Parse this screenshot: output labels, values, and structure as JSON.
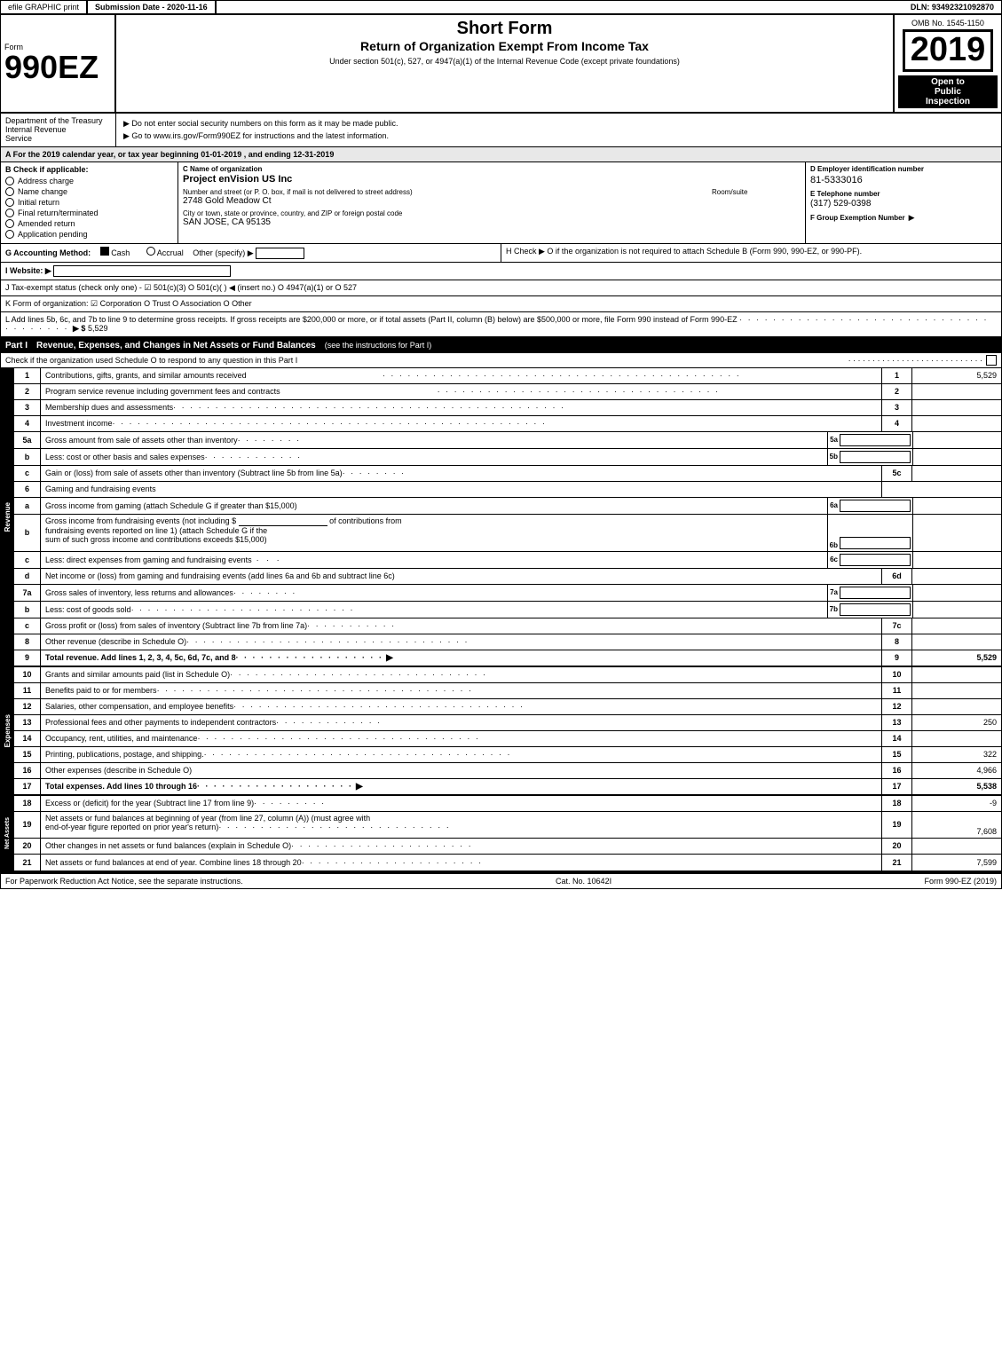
{
  "topbar": {
    "efile": "efile GRAPHIC print",
    "submission_label": "Submission Date - 2020-11-16",
    "dln_label": "DLN: 93492321092870"
  },
  "header": {
    "omb": "OMB No. 1545-1150",
    "form_number": "990EZ",
    "form_sub": "Form",
    "title_line1": "Short Form",
    "title_line2": "Return of Organization Exempt From Income Tax",
    "title_sub": "Under section 501(c), 527, or 4947(a)(1) of the Internal Revenue Code (except private foundations)",
    "year": "2019",
    "open_to_public": "Open to",
    "public": "Public",
    "inspection": "Inspection"
  },
  "instructions": {
    "no_ssn": "▶ Do not enter social security numbers on this form as it may be made public.",
    "goto": "▶ Go to www.irs.gov/Form990EZ for instructions and the latest information.",
    "dept": "Department of the Treasury",
    "treasury": "Internal Revenue",
    "service": "Service"
  },
  "sectionA": {
    "text": "A  For the 2019 calendar year, or tax year beginning 01-01-2019 , and ending 12-31-2019"
  },
  "sectionB": {
    "label": "B  Check if applicable:",
    "items": [
      "Address charge",
      "Name change",
      "Initial return",
      "Final return/terminated",
      "Amended return",
      "Application pending"
    ]
  },
  "sectionC": {
    "label": "C Name of organization",
    "org_name": "Project enVision US Inc",
    "address_label": "Number and street (or P. O. box, if mail is not delivered to street address)",
    "address_value": "2748 Gold Meadow Ct",
    "room_label": "Room/suite",
    "room_value": "",
    "city_label": "City or town, state or province, country, and ZIP or foreign postal code",
    "city_value": "SAN JOSE, CA  95135"
  },
  "sectionD": {
    "label": "D Employer identification number",
    "ein": "81-5333016",
    "phone_label": "E Telephone number",
    "phone": "(317) 529-0398",
    "group_label": "F Group Exemption Number",
    "group_value": ""
  },
  "sectionG": {
    "label": "G Accounting Method:",
    "cash": "Cash",
    "accrual": "Accrual",
    "other": "Other (specify) ▶"
  },
  "sectionH": {
    "text": "H  Check ▶  O if the organization is not required to attach Schedule B (Form 990, 990-EZ, or 990-PF)."
  },
  "websiteRow": {
    "label": "I Website: ▶"
  },
  "taxRow": {
    "text": "J Tax-exempt status (check only one) - ☑ 501(c)(3)  O 501(c)(   ) ◀ (insert no.)  O 4947(a)(1) or  O 527"
  },
  "formOrgRow": {
    "text": "K Form of organization:  ☑ Corporation    O Trust    O Association    O Other"
  },
  "sectionL": {
    "text": "L Add lines 5b, 6c, and 7b to line 9 to determine gross receipts. If gross receipts are $200,000 or more, or if total assets (Part II, column (B) below) are $500,000 or more, file Form 990 instead of Form 990-EZ",
    "dots": "· · · · · · · · · · · · · · · · · · · · · · · · · · · · · · · · · ·",
    "arrow": "▶ $",
    "value": "5,529"
  },
  "partI": {
    "label": "Part I",
    "title": "Revenue, Expenses, and Changes in Net Assets or Fund Balances",
    "see_instructions": "(see the instructions for Part I)",
    "check_text": "Check if the organization used Schedule O to respond to any question in this Part I",
    "rows": [
      {
        "num": "1",
        "desc": "Contributions, gifts, grants, and similar amounts received",
        "dots": true,
        "line": "1",
        "value": "5,529"
      },
      {
        "num": "2",
        "desc": "Program service revenue including government fees and contracts",
        "dots": true,
        "line": "2",
        "value": ""
      },
      {
        "num": "3",
        "desc": "Membership dues and assessments",
        "dots": true,
        "line": "3",
        "value": ""
      },
      {
        "num": "4",
        "desc": "Investment income",
        "dots": true,
        "line": "4",
        "value": ""
      }
    ],
    "row5": {
      "a": {
        "desc": "Gross amount from sale of assets other than inventory",
        "dots": false,
        "sub": "5a",
        "value": ""
      },
      "b": {
        "desc": "Less: cost or other basis and sales expenses",
        "dots": true,
        "sub": "5b",
        "value": ""
      },
      "c": {
        "desc": "Gain or (loss) from sale of assets other than inventory (Subtract line 5b from line 5a)",
        "dots": true,
        "line": "5c",
        "value": ""
      }
    },
    "row6": {
      "desc": "Gaming and fundraising events",
      "a": {
        "desc": "Gross income from gaming (attach Schedule G if greater than $15,000)",
        "sub": "6a",
        "value": ""
      },
      "b": {
        "desc": "Gross income from fundraising events (not including $",
        "blank": "_______________",
        "of": "of contributions from fundraising events reported on line 1) (attach Schedule G if the sum of such gross income and contributions exceeds $15,000)",
        "sub": "6b",
        "value": ""
      },
      "c": {
        "desc": "Less: direct expenses from gaming and fundraising events",
        "sub": "6c",
        "value": ""
      },
      "d": {
        "desc": "Net income or (loss) from gaming and fundraising events (add lines 6a and 6b and subtract line 6c)",
        "line": "6d",
        "value": ""
      }
    },
    "row7": {
      "a": {
        "desc": "Gross sales of inventory, less returns and allowances",
        "sub": "7a",
        "value": ""
      },
      "b": {
        "desc": "Less: cost of goods sold",
        "dots": true,
        "sub": "7b",
        "value": ""
      },
      "c": {
        "desc": "Gross profit or (loss) from sales of inventory (Subtract line 7b from line 7a)",
        "dots": true,
        "line": "7c",
        "value": ""
      }
    },
    "row8": {
      "desc": "Other revenue (describe in Schedule O)",
      "dots": true,
      "line": "8",
      "value": ""
    },
    "row9": {
      "desc": "Total revenue. Add lines 1, 2, 3, 4, 5c, 6d, 7c, and 8",
      "dots": true,
      "line": "9",
      "value": "5,529",
      "bold": true
    }
  },
  "expenses": {
    "label": "Expenses",
    "rows": [
      {
        "num": "10",
        "desc": "Grants and similar amounts paid (list in Schedule O)",
        "dots": true,
        "line": "10",
        "value": ""
      },
      {
        "num": "11",
        "desc": "Benefits paid to or for members",
        "dots": true,
        "line": "11",
        "value": ""
      },
      {
        "num": "12",
        "desc": "Salaries, other compensation, and employee benefits",
        "dots": true,
        "line": "12",
        "value": ""
      },
      {
        "num": "13",
        "desc": "Professional fees and other payments to independent contractors",
        "dots": true,
        "line": "13",
        "value": "250"
      },
      {
        "num": "14",
        "desc": "Occupancy, rent, utilities, and maintenance",
        "dots": true,
        "line": "14",
        "value": ""
      },
      {
        "num": "15",
        "desc": "Printing, publications, postage, and shipping.",
        "dots": true,
        "line": "15",
        "value": "322"
      },
      {
        "num": "16",
        "desc": "Other expenses (describe in Schedule O)",
        "dots": false,
        "line": "16",
        "value": "4,966"
      },
      {
        "num": "17",
        "desc": "Total expenses. Add lines 10 through 16",
        "dots": true,
        "line": "17",
        "value": "5,538",
        "bold": true,
        "arrow": true
      }
    ]
  },
  "netAssets": {
    "label": "Net Assets",
    "rows": [
      {
        "num": "18",
        "desc": "Excess or (deficit) for the year (Subtract line 17 from line 9)",
        "dots": false,
        "line": "18",
        "value": "-9"
      },
      {
        "num": "19",
        "desc": "Net assets or fund balances at beginning of year (from line 27, column (A)) (must agree with end-of-year figure reported on prior year's return)",
        "dots": true,
        "line": "19",
        "value": "7,608"
      },
      {
        "num": "20",
        "desc": "Other changes in net assets or fund balances (explain in Schedule O)",
        "dots": true,
        "line": "20",
        "value": ""
      },
      {
        "num": "21",
        "desc": "Net assets or fund balances at end of year. Combine lines 18 through 20",
        "dots": true,
        "line": "21",
        "value": "7,599"
      }
    ]
  },
  "footer": {
    "paperwork": "For Paperwork Reduction Act Notice, see the separate instructions.",
    "cat": "Cat. No. 10642I",
    "form": "Form 990-EZ (2019)"
  }
}
